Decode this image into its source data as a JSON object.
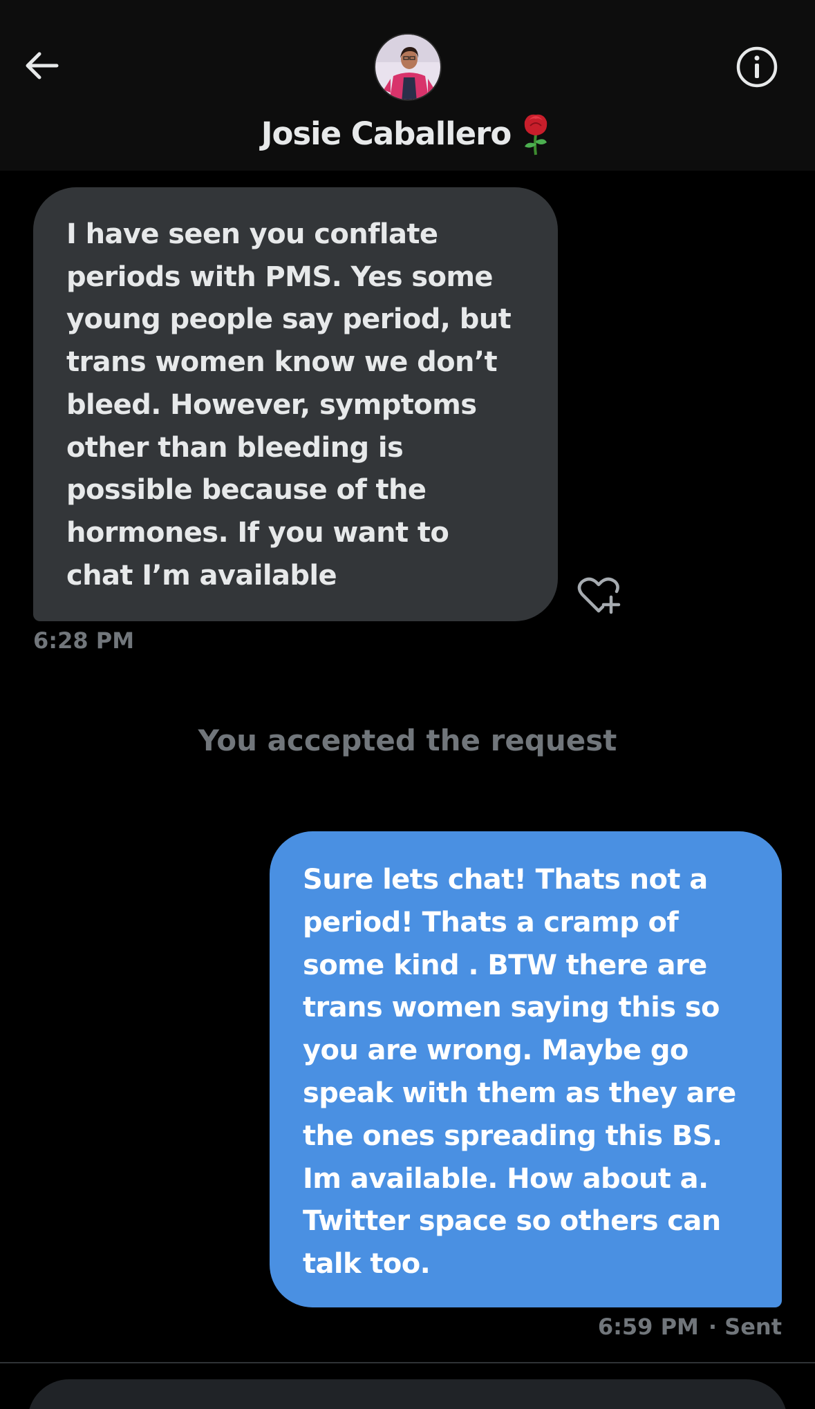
{
  "header": {
    "contact_name": "Josie Caballero",
    "back_icon": "arrow-left-icon",
    "info_icon": "info-circle-icon",
    "name_emoji_icon": "rose-icon"
  },
  "messages": [
    {
      "direction": "received",
      "text": "I have seen you conflate\nperiods with PMS. Yes some\nyoung people say period, but\ntrans women know we don’t\nbleed. However, symptoms\nother than bleeding is\npossible because of the\nhormones. If you want to\nchat I’m available",
      "time": "6:28 PM",
      "reaction_icon": "heart-plus-icon"
    },
    {
      "direction": "sent",
      "text": "Sure lets chat! Thats not a\nperiod! Thats a cramp of\nsome kind . BTW there are\ntrans women saying this so\nyou are wrong. Maybe go\nspeak with them as they are\nthe ones spreading this BS.\nIm available. How about a.\nTwitter space so others can\ntalk too.",
      "time": "6:59 PM",
      "status": "· Sent"
    }
  ],
  "system_note": "You accepted the request",
  "colors": {
    "background": "#000000",
    "received_bubble": "#333639",
    "sent_bubble": "#4a90e2",
    "muted_text": "#71767b"
  }
}
